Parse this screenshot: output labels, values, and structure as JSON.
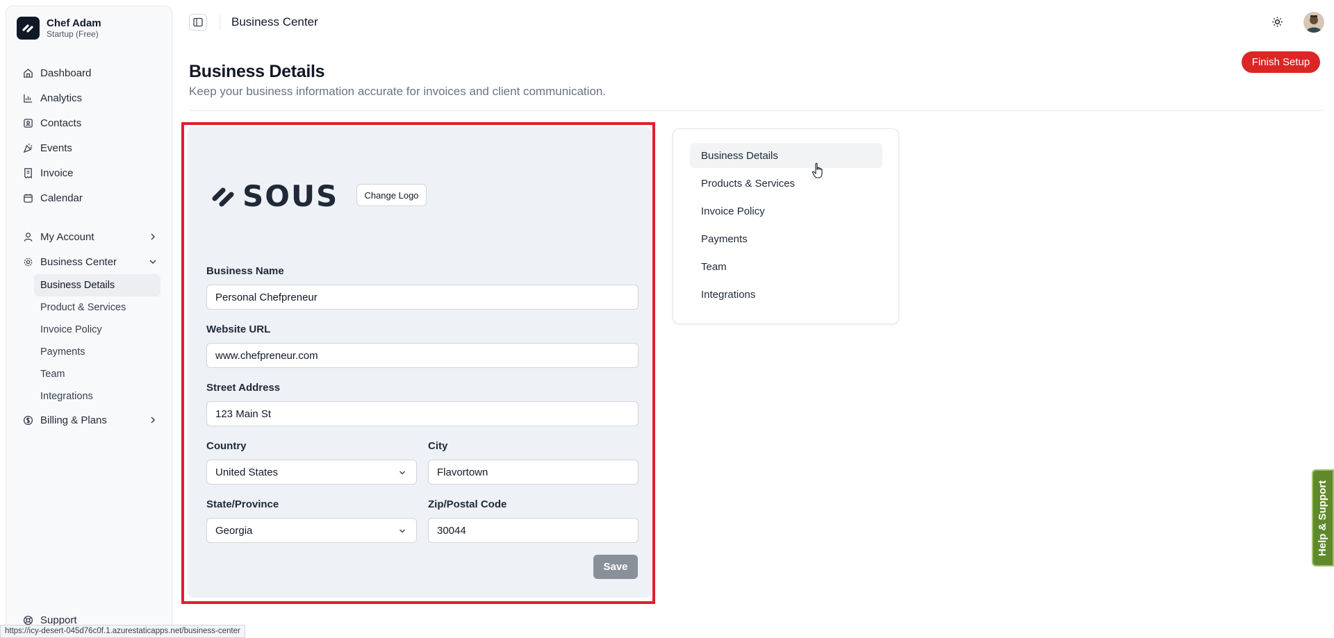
{
  "profile": {
    "name": "Chef Adam",
    "plan": "Startup (Free)"
  },
  "sidebar": {
    "items": [
      {
        "label": "Dashboard",
        "icon": "home-icon"
      },
      {
        "label": "Analytics",
        "icon": "bar-chart-icon"
      },
      {
        "label": "Contacts",
        "icon": "contact-card-icon"
      },
      {
        "label": "Events",
        "icon": "party-popper-icon"
      },
      {
        "label": "Invoice",
        "icon": "receipt-icon"
      },
      {
        "label": "Calendar",
        "icon": "calendar-icon"
      }
    ],
    "my_account": "My Account",
    "business_center": "Business Center",
    "sub_items": [
      "Business Details",
      "Product & Services",
      "Invoice Policy",
      "Payments",
      "Team",
      "Integrations"
    ],
    "billing": "Billing & Plans",
    "support": "Support"
  },
  "topbar": {
    "title": "Business Center"
  },
  "header": {
    "title": "Business Details",
    "subtitle": "Keep your business information accurate for invoices and client communication.",
    "finish_setup": "Finish Setup"
  },
  "form": {
    "logo_text": "SOUS",
    "change_logo": "Change Logo",
    "business_name_label": "Business Name",
    "business_name_value": "Personal Chefpreneur",
    "website_label": "Website URL",
    "website_value": "www.chefpreneur.com",
    "street_label": "Street Address",
    "street_value": "123 Main St",
    "country_label": "Country",
    "country_value": "United States",
    "city_label": "City",
    "city_value": "Flavortown",
    "state_label": "State/Province",
    "state_value": "Georgia",
    "zip_label": "Zip/Postal Code",
    "zip_value": "30044",
    "save": "Save"
  },
  "side_nav": {
    "items": [
      "Business Details",
      "Products & Services",
      "Invoice Policy",
      "Payments",
      "Team",
      "Integrations"
    ]
  },
  "help_tab": "Help & Support",
  "status_url": "https://icy-desert-045d76c0f.1.azurestaticapps.net/business-center",
  "colors": {
    "accent_red": "#dc2626",
    "highlight_red": "#e11d2f",
    "help_green": "#5f8a2b"
  }
}
